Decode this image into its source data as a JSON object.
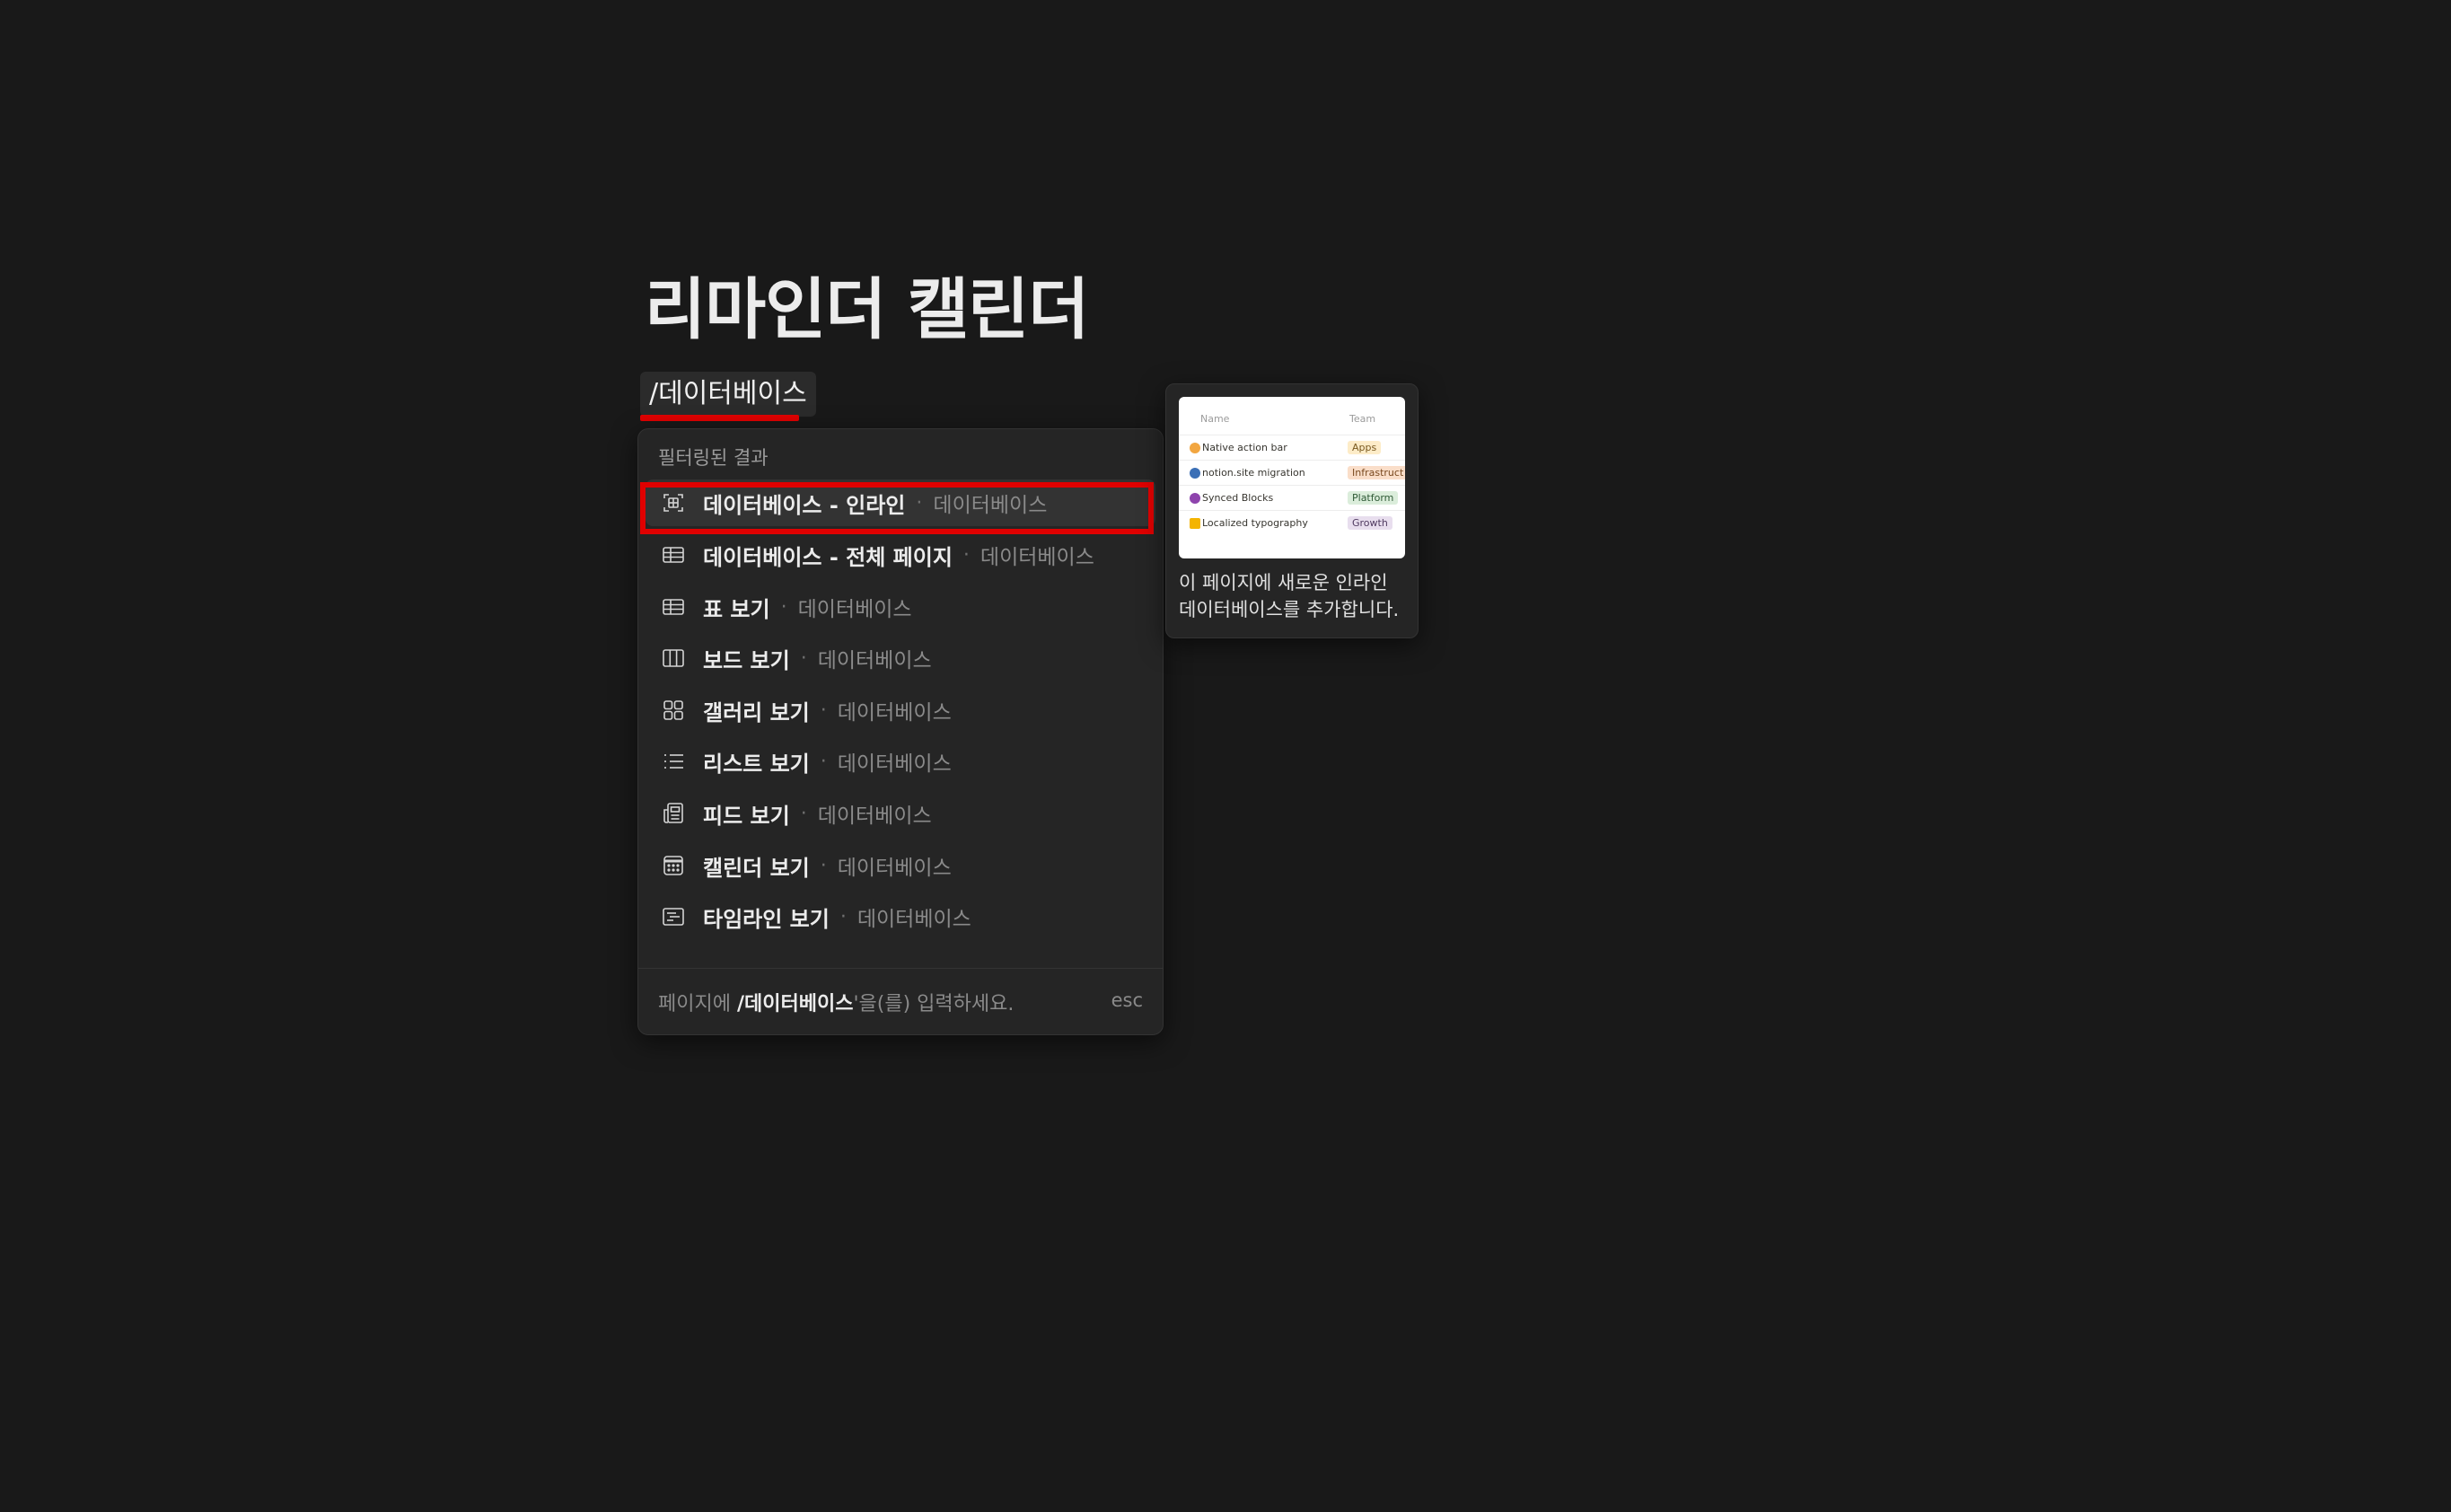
{
  "page": {
    "title": "리마인더 캘린더",
    "slash_command": "/데이터베이스"
  },
  "menu": {
    "header": "필터링된 결과",
    "items": [
      {
        "label": "데이터베이스 - 인라인",
        "sub": "데이터베이스",
        "icon": "inline-database-icon",
        "selected": true
      },
      {
        "label": "데이터베이스 - 전체 페이지",
        "sub": "데이터베이스",
        "icon": "table-icon"
      },
      {
        "label": "표 보기",
        "sub": "데이터베이스",
        "icon": "table-icon"
      },
      {
        "label": "보드 보기",
        "sub": "데이터베이스",
        "icon": "board-icon"
      },
      {
        "label": "갤러리 보기",
        "sub": "데이터베이스",
        "icon": "gallery-icon"
      },
      {
        "label": "리스트 보기",
        "sub": "데이터베이스",
        "icon": "list-icon"
      },
      {
        "label": "피드 보기",
        "sub": "데이터베이스",
        "icon": "feed-icon"
      },
      {
        "label": "캘린더 보기",
        "sub": "데이터베이스",
        "icon": "calendar-icon"
      },
      {
        "label": "타임라인 보기",
        "sub": "데이터베이스",
        "icon": "timeline-icon"
      }
    ],
    "separator": "·",
    "footer_prefix": "페이지에 ",
    "footer_query": "/데이터베이스",
    "footer_suffix": "'을(를) 입력하세요.",
    "esc_label": "esc"
  },
  "preview": {
    "header_name": "Name",
    "header_team": "Team",
    "rows": [
      {
        "name": "Native action bar",
        "tag": "Apps",
        "tag_color": "#fdecc8",
        "emoji_color": "#f2a640"
      },
      {
        "name": "notion.site migration",
        "tag": "Infrastruct",
        "tag_color": "#fadec9",
        "emoji_color": "#3b6fb6"
      },
      {
        "name": "Synced Blocks",
        "tag": "Platform",
        "tag_color": "#dbeddb",
        "emoji_color": "#8e44ad"
      },
      {
        "name": "Localized typography",
        "tag": "Growth",
        "tag_color": "#e8deee",
        "emoji_color": "#f4b400"
      }
    ],
    "description": "이 페이지에 새로운 인라인 데이터베이스를 추가합니다."
  },
  "colors": {
    "background": "#191919",
    "menu_bg": "#252525",
    "selected_bg": "#333333",
    "highlight": "#e00000"
  }
}
